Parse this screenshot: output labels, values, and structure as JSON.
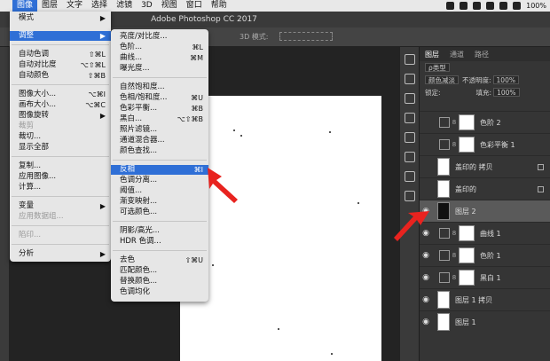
{
  "menubar": {
    "items": [
      "图像",
      "图层",
      "文字",
      "选择",
      "滤镜",
      "3D",
      "视图",
      "窗口",
      "帮助"
    ],
    "battery": "100%"
  },
  "app_title": "Adobe Photoshop CC 2017",
  "optionsbar": {
    "mode3d": "3D 模式:"
  },
  "image_menu": {
    "items": [
      {
        "label": "模式",
        "sub": true
      },
      {
        "label": "调整",
        "sub": true,
        "highlight": true
      },
      {
        "label": "自动色调",
        "shortcut": "⇧⌘L"
      },
      {
        "label": "自动对比度",
        "shortcut": "⌥⇧⌘L"
      },
      {
        "label": "自动颜色",
        "shortcut": "⇧⌘B"
      },
      {
        "label": "图像大小...",
        "shortcut": "⌥⌘I"
      },
      {
        "label": "画布大小...",
        "shortcut": "⌥⌘C"
      },
      {
        "label": "图像旋转",
        "sub": true
      },
      {
        "label": "裁剪",
        "disabled": true
      },
      {
        "label": "裁切..."
      },
      {
        "label": "显示全部"
      },
      {
        "label": "复制..."
      },
      {
        "label": "应用图像..."
      },
      {
        "label": "计算..."
      },
      {
        "label": "变量",
        "sub": true
      },
      {
        "label": "应用数据组...",
        "disabled": true
      },
      {
        "label": "陷印...",
        "disabled": true
      },
      {
        "label": "分析",
        "sub": true
      }
    ]
  },
  "adjust_menu": {
    "items": [
      {
        "label": "亮度/对比度..."
      },
      {
        "label": "色阶...",
        "shortcut": "⌘L"
      },
      {
        "label": "曲线...",
        "shortcut": "⌘M"
      },
      {
        "label": "曝光度..."
      },
      {
        "label": "自然饱和度..."
      },
      {
        "label": "色相/饱和度...",
        "shortcut": "⌘U"
      },
      {
        "label": "色彩平衡...",
        "shortcut": "⌘B"
      },
      {
        "label": "黑白...",
        "shortcut": "⌥⇧⌘B"
      },
      {
        "label": "照片滤镜..."
      },
      {
        "label": "通道混合器..."
      },
      {
        "label": "颜色查找..."
      },
      {
        "label": "反相",
        "shortcut": "⌘I",
        "highlight": true
      },
      {
        "label": "色调分离..."
      },
      {
        "label": "阈值..."
      },
      {
        "label": "渐变映射..."
      },
      {
        "label": "可选颜色..."
      },
      {
        "label": "阴影/高光..."
      },
      {
        "label": "HDR 色调..."
      },
      {
        "label": "去色",
        "shortcut": "⇧⌘U"
      },
      {
        "label": "匹配颜色..."
      },
      {
        "label": "替换颜色..."
      },
      {
        "label": "色调均化"
      }
    ]
  },
  "layers_panel": {
    "tabs": [
      "图层",
      "通道",
      "路径"
    ],
    "filter_kind": "ρ类型",
    "blend_mode": "颜色减淡",
    "opacity_label": "不透明度:",
    "opacity_value": "100%",
    "lock_label": "锁定:",
    "fill_label": "填充:",
    "fill_value": "100%",
    "layers": [
      {
        "name": "色阶 2",
        "visible": false
      },
      {
        "name": "色彩平衡 1",
        "visible": false
      },
      {
        "name": "盖印的 拷贝",
        "visible": false
      },
      {
        "name": "盖印的",
        "visible": false
      },
      {
        "name": "图层 2",
        "visible": true,
        "selected": true
      },
      {
        "name": "曲线 1",
        "visible": true
      },
      {
        "name": "色阶 1",
        "visible": true
      },
      {
        "name": "黑白 1",
        "visible": true
      },
      {
        "name": "图层 1 拷贝",
        "visible": true
      },
      {
        "name": "图层 1",
        "visible": true
      }
    ]
  },
  "colors": {
    "highlight": "#2f6fd6",
    "annotation_arrow": "#e8231f"
  }
}
